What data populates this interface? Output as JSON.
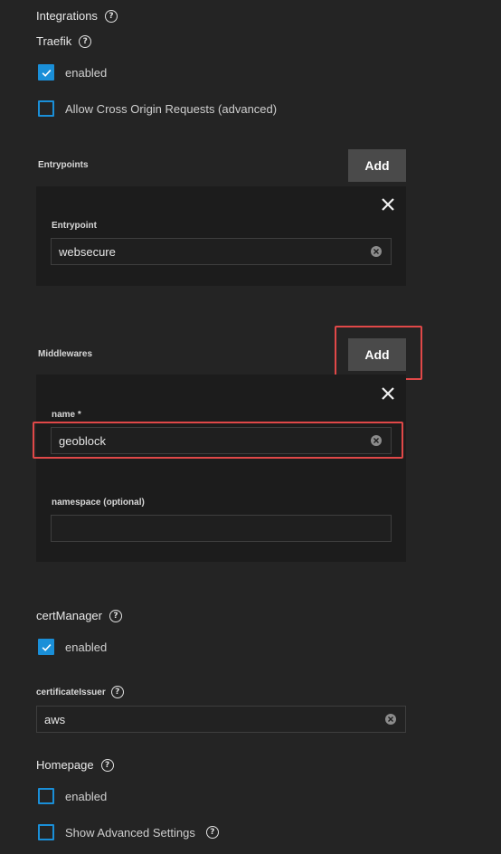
{
  "integrations": {
    "title": "Integrations"
  },
  "traefik": {
    "title": "Traefik",
    "enabled_label": "enabled",
    "cors_label": "Allow Cross Origin Requests (advanced)",
    "entrypoints": {
      "label": "Entrypoints",
      "add_label": "Add",
      "field_label": "Entrypoint",
      "field_value": "websecure"
    },
    "middlewares": {
      "label": "Middlewares",
      "add_label": "Add",
      "name_label": "name *",
      "name_value": "geoblock",
      "namespace_label": "namespace (optional)",
      "namespace_value": ""
    }
  },
  "certManager": {
    "title": "certManager",
    "enabled_label": "enabled",
    "issuer_label": "certificateIssuer",
    "issuer_value": "aws"
  },
  "homepage": {
    "title": "Homepage",
    "enabled_label": "enabled",
    "advanced_label": "Show Advanced Settings"
  },
  "colors": {
    "accent": "#1a8fd8",
    "highlight": "#e04848",
    "background": "#242424"
  }
}
